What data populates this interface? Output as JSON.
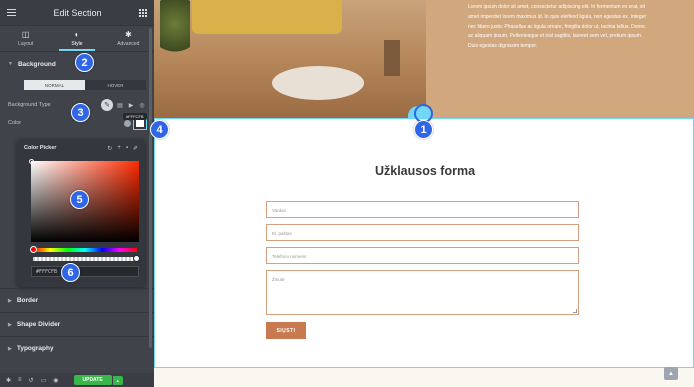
{
  "sidebar": {
    "title": "Edit Section",
    "tabs": [
      {
        "label": "Layout",
        "icon": "layout-icon"
      },
      {
        "label": "Style",
        "icon": "style-icon"
      },
      {
        "label": "Advanced",
        "icon": "gear-icon"
      }
    ],
    "background_section": "Background",
    "state_toggle": {
      "normal": "NORMAL",
      "hover": "HOVER"
    },
    "background_type_label": "Background Type",
    "color_label": "Color",
    "color_tooltip": "#FFFCFB",
    "color_picker": {
      "title": "Color Picker",
      "hex_value": "#FFFCFB"
    },
    "lower_sections": [
      "Border",
      "Shape Divider",
      "Typography"
    ],
    "footer": {
      "update_label": "UPDATE"
    }
  },
  "hero": {
    "paragraph": "Lorem ipsum dolor sit amet, consectetur adipiscing elit. In fermentum ex erat, sit amet imperdiet lorem maximus id. In quis eleifend ligula, non egestas ex. Integer nec libero justo. Phasellus ac ligula ornare, fringilla dolor ut, lacinia tellus. Donec ac aliquam ipsum. Pellentesque et nisl sagittis, laoreet sem vel, pretium ipsum. Duis egestas dignissim tempor."
  },
  "form": {
    "title": "Užklausos forma",
    "name_placeholder": "Vardas",
    "email_placeholder": "El. paštas",
    "phone_placeholder": "Telefono numeris",
    "message_placeholder": "Žinutė",
    "submit_label": "SIŲSTI"
  },
  "markers": [
    "1",
    "2",
    "3",
    "4",
    "5",
    "6"
  ],
  "colors": {
    "accent": "#71d7f7",
    "marker": "#2f66e8",
    "button": "#c9794f",
    "update": "#39b54a"
  }
}
